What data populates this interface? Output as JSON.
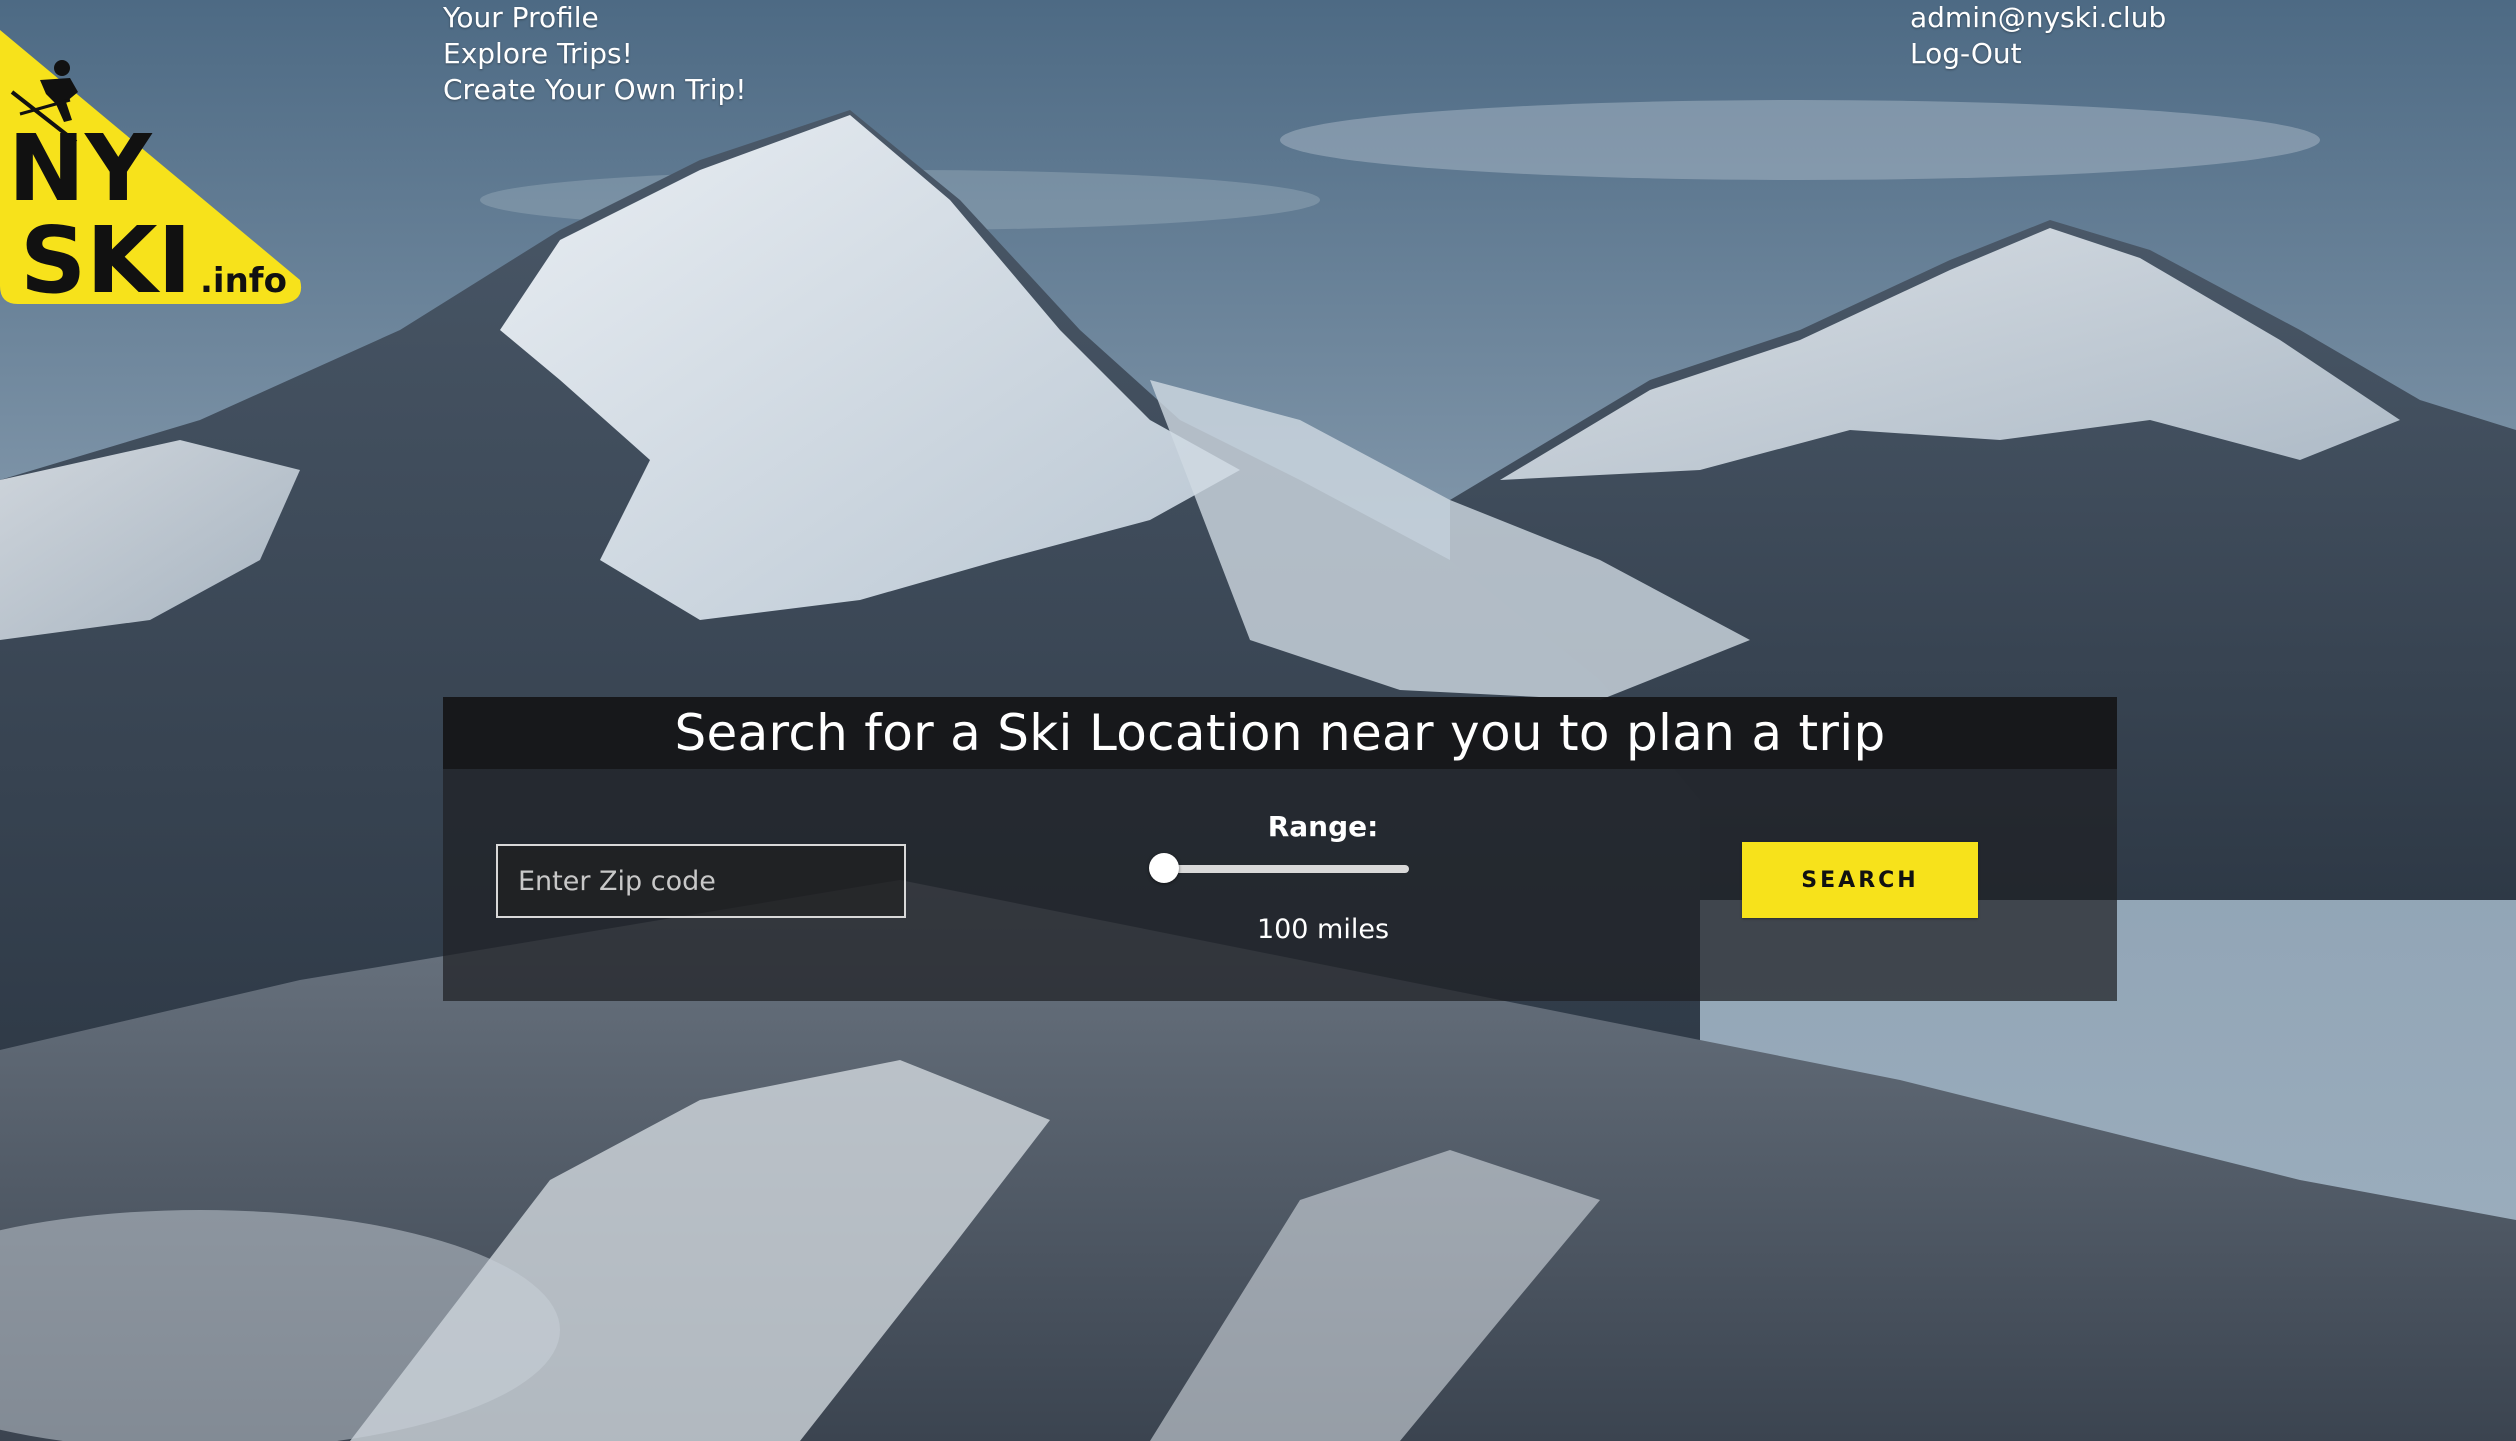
{
  "nav": {
    "profile": "Your Profile",
    "explore": "Explore Trips!",
    "create": "Create Your Own Trip!"
  },
  "account": {
    "email": "admin@nyski.club",
    "logout": "Log-Out"
  },
  "logo": {
    "line1": "NY",
    "line2": "SKI",
    "suffix": ".info",
    "color": "#f7e21b"
  },
  "search": {
    "title": "Search for a Ski Location near you to plan a trip",
    "zip_placeholder": "Enter Zip code",
    "zip_value": "",
    "range_label": "Range:",
    "range_value_text": "100 miles",
    "button_label": "SEARCH",
    "button_color": "#f7e21b"
  }
}
